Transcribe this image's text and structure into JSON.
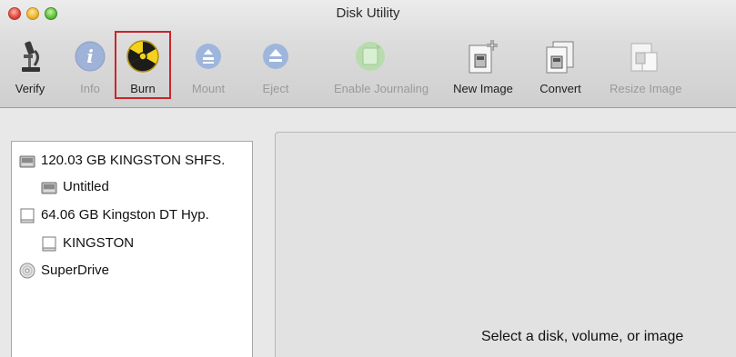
{
  "window": {
    "title": "Disk Utility"
  },
  "toolbar": {
    "items": [
      {
        "label": "Verify",
        "icon": "microscope-icon",
        "enabled": true
      },
      {
        "label": "Info",
        "icon": "info-icon",
        "enabled": false
      },
      {
        "label": "Burn",
        "icon": "burn-icon",
        "enabled": true,
        "highlighted": true
      },
      {
        "label": "Mount",
        "icon": "mount-icon",
        "enabled": false
      },
      {
        "label": "Eject",
        "icon": "eject-icon",
        "enabled": false
      },
      {
        "label": "Enable Journaling",
        "icon": "journaling-icon",
        "enabled": false
      },
      {
        "label": "New Image",
        "icon": "new-image-icon",
        "enabled": true
      },
      {
        "label": "Convert",
        "icon": "convert-icon",
        "enabled": true
      },
      {
        "label": "Resize Image",
        "icon": "resize-image-icon",
        "enabled": false
      }
    ]
  },
  "sidebar": {
    "items": [
      {
        "label": "120.03 GB KINGSTON SHFS.",
        "icon": "hard-drive-icon"
      },
      {
        "label": "Untitled",
        "icon": "volume-icon"
      },
      {
        "label": "64.06 GB Kingston DT Hyp.",
        "icon": "usb-drive-icon"
      },
      {
        "label": "KINGSTON",
        "icon": "usb-volume-icon"
      },
      {
        "label": "SuperDrive",
        "icon": "optical-drive-icon"
      }
    ]
  },
  "main": {
    "hint": "Select a disk, volume, or image"
  },
  "colors": {
    "highlight": "#c9262c",
    "burn_yellow": "#f2d21c"
  }
}
